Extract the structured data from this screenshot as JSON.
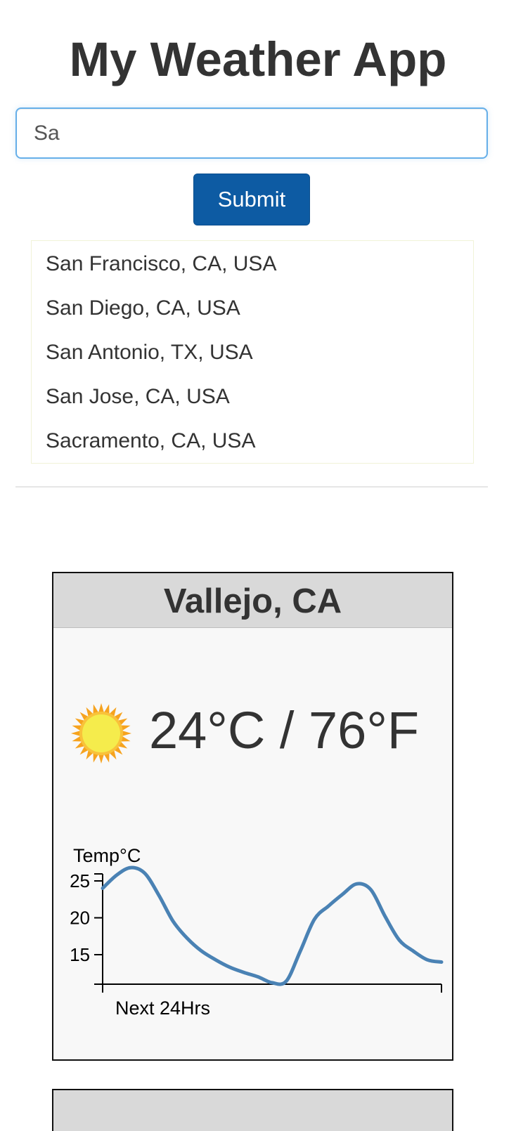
{
  "app": {
    "title": "My Weather App"
  },
  "search": {
    "value": "Sa",
    "placeholder": ""
  },
  "submit_label": "Submit",
  "suggestions": [
    "San Francisco, CA, USA",
    "San Diego, CA, USA",
    "San Antonio, TX, USA",
    "San Jose, CA, USA",
    "Sacramento, CA, USA"
  ],
  "card": {
    "city": "Vallejo, CA",
    "temperature": "24°C / 76°F",
    "icon": "sun-icon"
  },
  "colors": {
    "accent": "#0d5ba3",
    "line": "#4a82b4",
    "sun_inner": "#f5ec4c",
    "sun_outer": "#f6a31f"
  },
  "chart_data": {
    "type": "line",
    "ylabel": "Temp°C",
    "xlabel": "Next 24Hrs",
    "yticks": [
      15,
      20,
      25
    ],
    "ylim": [
      11,
      27
    ],
    "xlim": [
      0,
      24
    ],
    "grid": false,
    "series": [
      {
        "x": [
          0,
          1,
          2,
          3,
          4,
          5,
          6,
          7,
          8,
          9,
          10,
          11,
          12,
          13,
          14,
          15,
          16,
          17,
          18,
          19,
          20,
          21,
          22,
          23,
          24
        ],
        "values": [
          24.0,
          25.8,
          26.8,
          26.0,
          23.0,
          19.5,
          17.2,
          15.5,
          14.3,
          13.3,
          12.6,
          12.0,
          11.2,
          11.4,
          15.5,
          19.8,
          21.6,
          23.2,
          24.6,
          23.8,
          20.2,
          17.0,
          15.5,
          14.3,
          14.0
        ]
      }
    ]
  }
}
